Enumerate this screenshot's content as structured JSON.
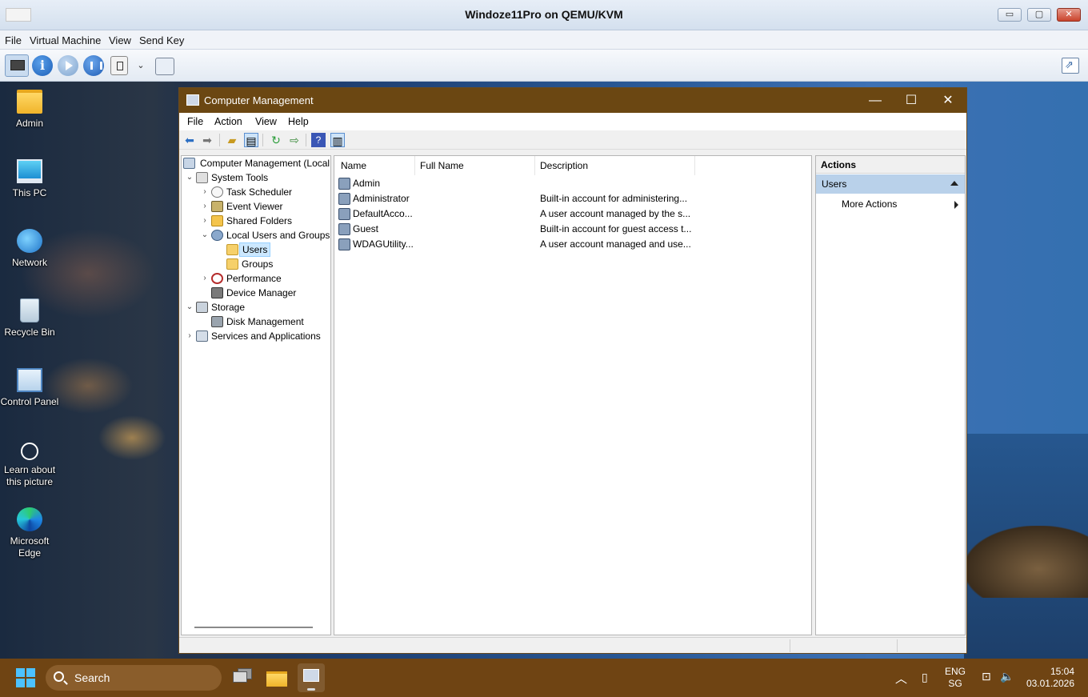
{
  "host": {
    "title": "Windoze11Pro on QEMU/KVM",
    "menu": [
      "File",
      "Virtual Machine",
      "View",
      "Send Key"
    ],
    "buttons": {
      "minimize": "▭",
      "maximize": "▢",
      "close": "✕"
    }
  },
  "desktop": {
    "icons": [
      {
        "label": "Admin",
        "icon": "folder-icon"
      },
      {
        "label": "This PC",
        "icon": "monitor-icon"
      },
      {
        "label": "Network",
        "icon": "network-icon"
      },
      {
        "label": "Recycle Bin",
        "icon": "recycle-bin-icon"
      },
      {
        "label": "Control Panel",
        "icon": "control-panel-icon"
      },
      {
        "label": "Learn about this picture",
        "icon": "camera-icon"
      },
      {
        "label": "Microsoft Edge",
        "icon": "edge-icon"
      }
    ]
  },
  "cm": {
    "title": "Computer Management",
    "menu": [
      "File",
      "Action",
      "View",
      "Help"
    ],
    "tree": {
      "root": "Computer Management (Local",
      "system_tools": "System Tools",
      "task_scheduler": "Task Scheduler",
      "event_viewer": "Event Viewer",
      "shared_folders": "Shared Folders",
      "local_users": "Local Users and Groups",
      "users": "Users",
      "groups": "Groups",
      "performance": "Performance",
      "device_manager": "Device Manager",
      "storage": "Storage",
      "disk_management": "Disk Management",
      "services": "Services and Applications"
    },
    "columns": {
      "name": "Name",
      "full_name": "Full Name",
      "description": "Description"
    },
    "rows": [
      {
        "name": "Admin",
        "full_name": "",
        "description": ""
      },
      {
        "name": "Administrator",
        "full_name": "",
        "description": "Built-in account for administering..."
      },
      {
        "name": "DefaultAcco...",
        "full_name": "",
        "description": "A user account managed by the s..."
      },
      {
        "name": "Guest",
        "full_name": "",
        "description": "Built-in account for guest access t..."
      },
      {
        "name": "WDAGUtility...",
        "full_name": "",
        "description": "A user account managed and use..."
      }
    ],
    "actions": {
      "header": "Actions",
      "section": "Users",
      "more": "More Actions"
    }
  },
  "taskbar": {
    "search_placeholder": "Search",
    "lang": "ENG",
    "region": "SG",
    "time": "15:04",
    "date": "03.01.2026"
  }
}
